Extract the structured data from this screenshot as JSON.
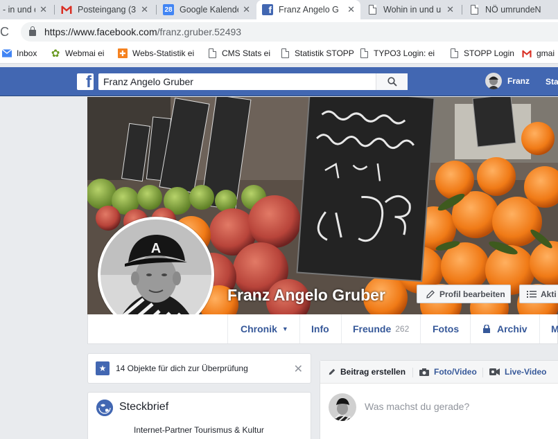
{
  "browser": {
    "tabs": [
      {
        "title": "- in und d",
        "active": false,
        "icon": "doc-icon"
      },
      {
        "title": "Posteingang (3.",
        "active": false,
        "icon": "gmail-icon"
      },
      {
        "title": "Google Kalende",
        "active": false,
        "icon": "calendar-icon",
        "icon_text": "28"
      },
      {
        "title": "Franz Angelo G",
        "active": true,
        "icon": "facebook-icon"
      },
      {
        "title": "Wohin in und u",
        "active": false,
        "icon": "doc-icon"
      },
      {
        "title": "NÖ umrundeN",
        "active": false,
        "icon": "doc-icon"
      }
    ],
    "url_host": "https://www.facebook.com",
    "url_path": "/franz.gruber.52493",
    "bookmarks": [
      {
        "label": "Inbox",
        "icon": "mail-icon"
      },
      {
        "label": "Webmai ei",
        "icon": "gear-icon"
      },
      {
        "label": "Webs-Statistik ei",
        "icon": "stats-icon"
      },
      {
        "label": "CMS Stats ei",
        "icon": "doc-icon"
      },
      {
        "label": "Statistik STOPP",
        "icon": "doc-icon"
      },
      {
        "label": "TYPO3 Login: ei",
        "icon": "doc-icon"
      },
      {
        "label": "STOPP Login",
        "icon": "doc-icon"
      },
      {
        "label": "gmai",
        "icon": "gmail-icon"
      }
    ]
  },
  "fb_header": {
    "search_value": "Franz Angelo Gruber",
    "user_name": "Franz",
    "start_label": "Sta"
  },
  "profile": {
    "name": "Franz Angelo Gruber",
    "edit_button": "Profil bearbeiten",
    "activity_button": "Akti",
    "tabs": [
      {
        "label": "Chronik",
        "dropdown": true
      },
      {
        "label": "Info"
      },
      {
        "label": "Freunde",
        "count": "262"
      },
      {
        "label": "Fotos"
      },
      {
        "label": "Archiv",
        "locked": true
      },
      {
        "label": "M"
      }
    ]
  },
  "notice": {
    "text": "14 Objekte für dich zur Überprüfung"
  },
  "steckbrief": {
    "title": "Steckbrief",
    "line1": "Internet-Partner Tourismus & Kultur"
  },
  "composer": {
    "tab_post": "Beitrag erstellen",
    "tab_photo": "Foto/Video",
    "tab_live": "Live-Video",
    "placeholder": "Was machst du gerade?"
  },
  "colors": {
    "fb_blue": "#4267b2",
    "link_blue": "#365899",
    "gmail_red": "#d93025"
  }
}
